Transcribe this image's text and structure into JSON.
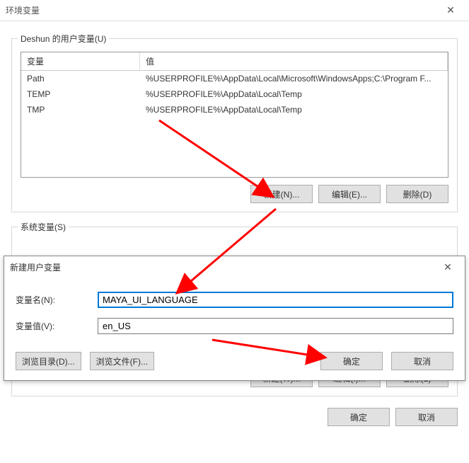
{
  "window": {
    "title": "环境变量"
  },
  "user_vars": {
    "group_title": "Deshun 的用户变量(U)",
    "col_name": "变量",
    "col_value": "值",
    "rows": [
      {
        "name": "Path",
        "value": "%USERPROFILE%\\AppData\\Local\\Microsoft\\WindowsApps;C:\\Program F..."
      },
      {
        "name": "TEMP",
        "value": "%USERPROFILE%\\AppData\\Local\\Temp"
      },
      {
        "name": "TMP",
        "value": "%USERPROFILE%\\AppData\\Local\\Temp"
      }
    ],
    "btn_new": "新建(N)...",
    "btn_edit": "编辑(E)...",
    "btn_delete": "删除(D)"
  },
  "system_vars": {
    "group_title": "系统变量(S)",
    "btn_new": "新建(W)...",
    "btn_edit": "编辑(I)...",
    "btn_delete": "删除(L)"
  },
  "bottom": {
    "btn_ok": "确定",
    "btn_cancel": "取消"
  },
  "dialog": {
    "title": "新建用户变量",
    "label_name": "变量名(N):",
    "label_value": "变量值(V):",
    "value_name": "MAYA_UI_LANGUAGE",
    "value_value": "en_US",
    "btn_browse_dir": "浏览目录(D)...",
    "btn_browse_file": "浏览文件(F)...",
    "btn_ok": "确定",
    "btn_cancel": "取消"
  }
}
